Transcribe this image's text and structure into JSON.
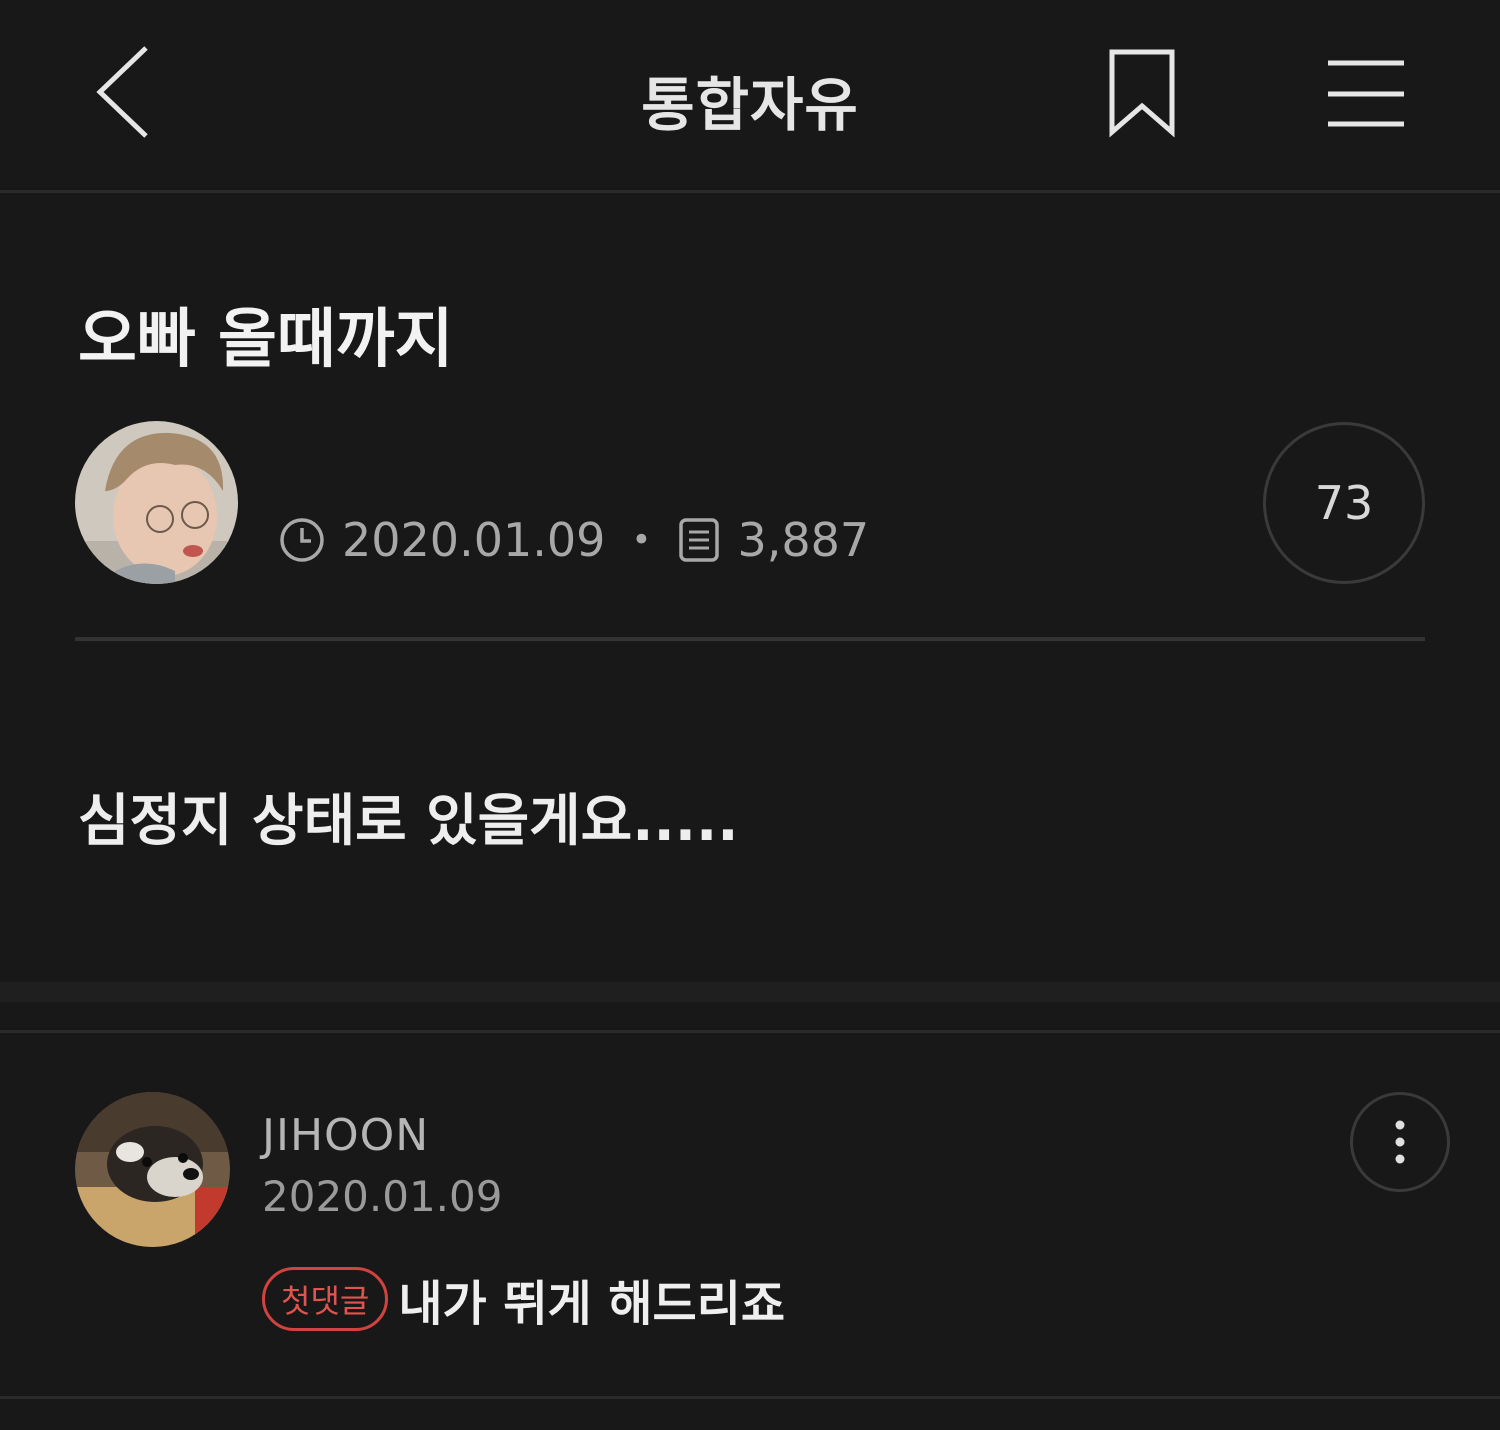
{
  "header": {
    "title": "통합자유",
    "back_icon": "chevron-left-icon",
    "bookmark_icon": "bookmark-icon",
    "menu_icon": "hamburger-menu-icon"
  },
  "post": {
    "title": "오빠 올때까지",
    "date": "2020.01.09",
    "separator": "•",
    "views": "3,887",
    "comment_count": "73",
    "body": "심정지 상태로 있을게요....."
  },
  "comments": [
    {
      "author": "JIHOON",
      "date": "2020.01.09",
      "badge": "첫댓글",
      "text": "내가 뛰게 해드리죠"
    }
  ],
  "colors": {
    "background": "#181818",
    "badge": "#d2433f",
    "text": "#ebebeb",
    "muted": "#a8a8a8"
  }
}
